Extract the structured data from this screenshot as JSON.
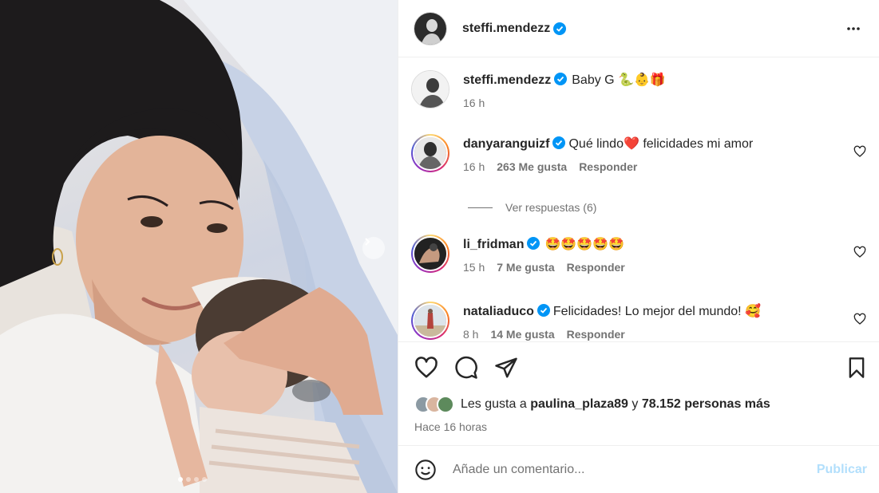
{
  "post": {
    "author": "steffi.mendezz",
    "caption": "Baby G",
    "caption_emojis": "🐍👶🎁",
    "caption_time": "16 h"
  },
  "comments": [
    {
      "user": "danyaranguizf",
      "text": "Qué lindo",
      "text_after": " felicidades mi amor",
      "emoji": "❤️",
      "time": "16 h",
      "likes": "263 Me gusta",
      "reply": "Responder"
    },
    {
      "user": "li_fridman",
      "text": "",
      "emoji": "🤩🤩🤩🤩🤩",
      "time": "15 h",
      "likes": "7 Me gusta",
      "reply": "Responder"
    },
    {
      "user": "nataliaduco",
      "text": "Felicidades! Lo mejor del mundo!",
      "emoji": "🥰",
      "time": "8 h",
      "likes": "14 Me gusta",
      "reply": "Responder"
    }
  ],
  "replies_label": "Ver respuestas (6)",
  "likes": {
    "prefix": "Les gusta a",
    "user": "paulina_plaza89",
    "conj": "y",
    "others": "78.152 personas más"
  },
  "post_time": "Hace 16 horas",
  "comment_input": {
    "placeholder": "Añade un comentario..."
  },
  "publish_label": "Publicar",
  "carousel": {
    "current": 1,
    "total": 4
  },
  "colors": {
    "verified": "#0095f6",
    "publish": "#b2dffc",
    "secondary_text": "#737373"
  }
}
